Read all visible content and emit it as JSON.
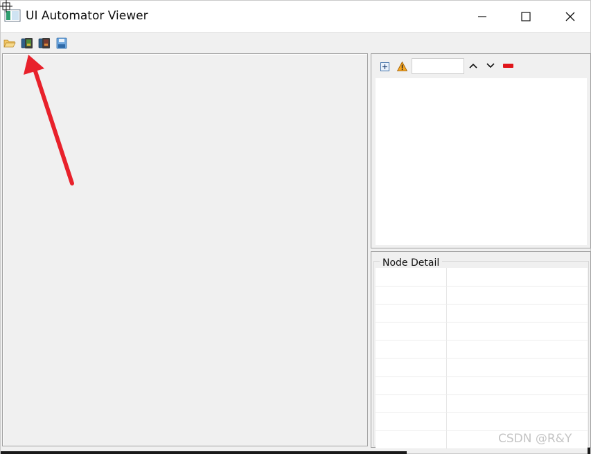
{
  "window": {
    "title": "UI Automator Viewer",
    "controls": [
      "minimize-icon",
      "maximize-icon",
      "close-icon"
    ]
  },
  "toolbar": {
    "buttons": [
      "open-folder-icon",
      "device-screenshot-icon",
      "device-screenshot-compressed-icon",
      "save-icon"
    ]
  },
  "tree_panel": {
    "buttons": [
      "expand-all-icon",
      "warning-icon",
      "previous-arrow-icon",
      "next-arrow-icon",
      "clear-icon"
    ],
    "search_value": ""
  },
  "node_detail": {
    "title": "Node Detail",
    "rows": 10
  },
  "watermark": "CSDN @R&Y",
  "colors": {
    "annotation_arrow": "#e8212b",
    "clear_button": "#e0151a",
    "warning": "#f5a623"
  }
}
